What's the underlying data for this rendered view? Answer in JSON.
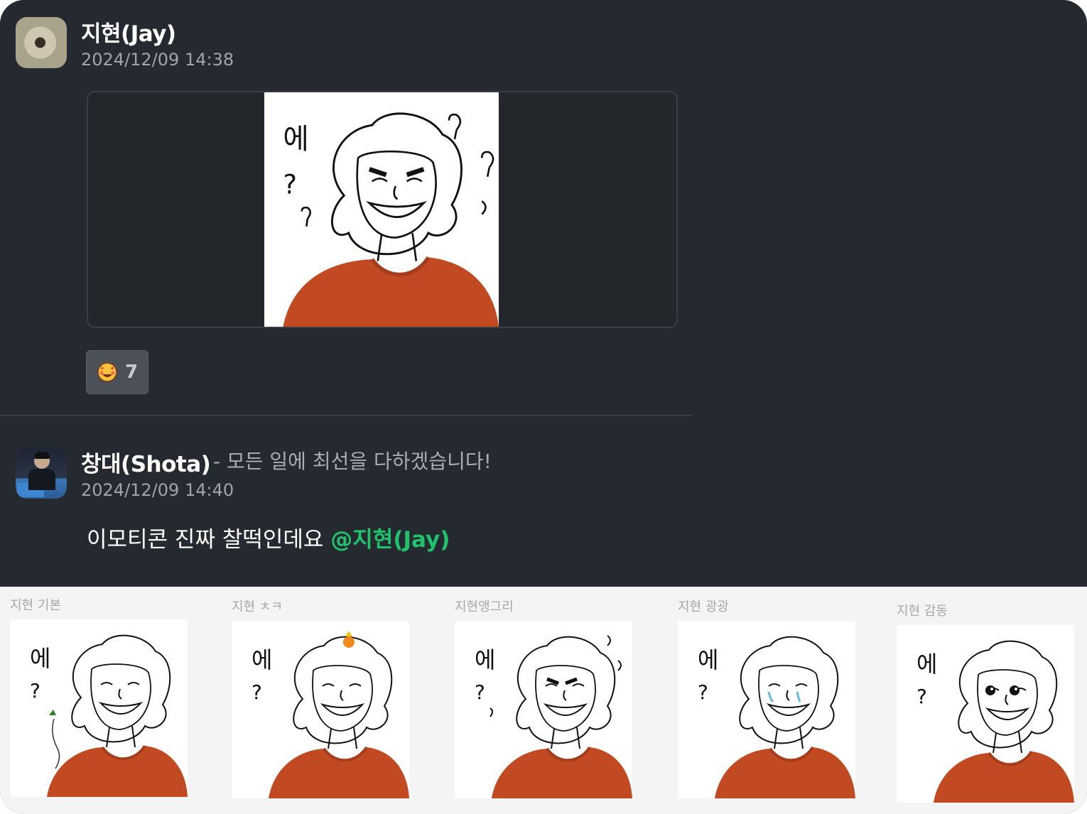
{
  "messages": [
    {
      "author": "지현(Jay)",
      "timestamp": "2024/12/09 14:38",
      "attachment": {
        "type": "sticker",
        "caption_line1": "에",
        "caption_line2": "?"
      },
      "reactions": [
        {
          "emoji_name": "star-struck-face",
          "count": "7"
        }
      ]
    },
    {
      "author": "창대(Shota)",
      "status": "- 모든 일에 최선을 다하겠습니다!",
      "timestamp": "2024/12/09 14:40",
      "text": "이모티콘 진짜 찰떡인데요 ",
      "mention": "@지현(Jay)"
    }
  ],
  "sticker_palette": [
    {
      "label": "지현 기본"
    },
    {
      "label": "지현 ㅊㅋ"
    },
    {
      "label": "지현앵그리"
    },
    {
      "label": "지현 광광"
    },
    {
      "label": "지현 감동"
    }
  ],
  "colors": {
    "background": "#252930",
    "mention": "#1fc36b",
    "sweater": "#c24a22",
    "palette_bg": "#f4f4f4"
  }
}
